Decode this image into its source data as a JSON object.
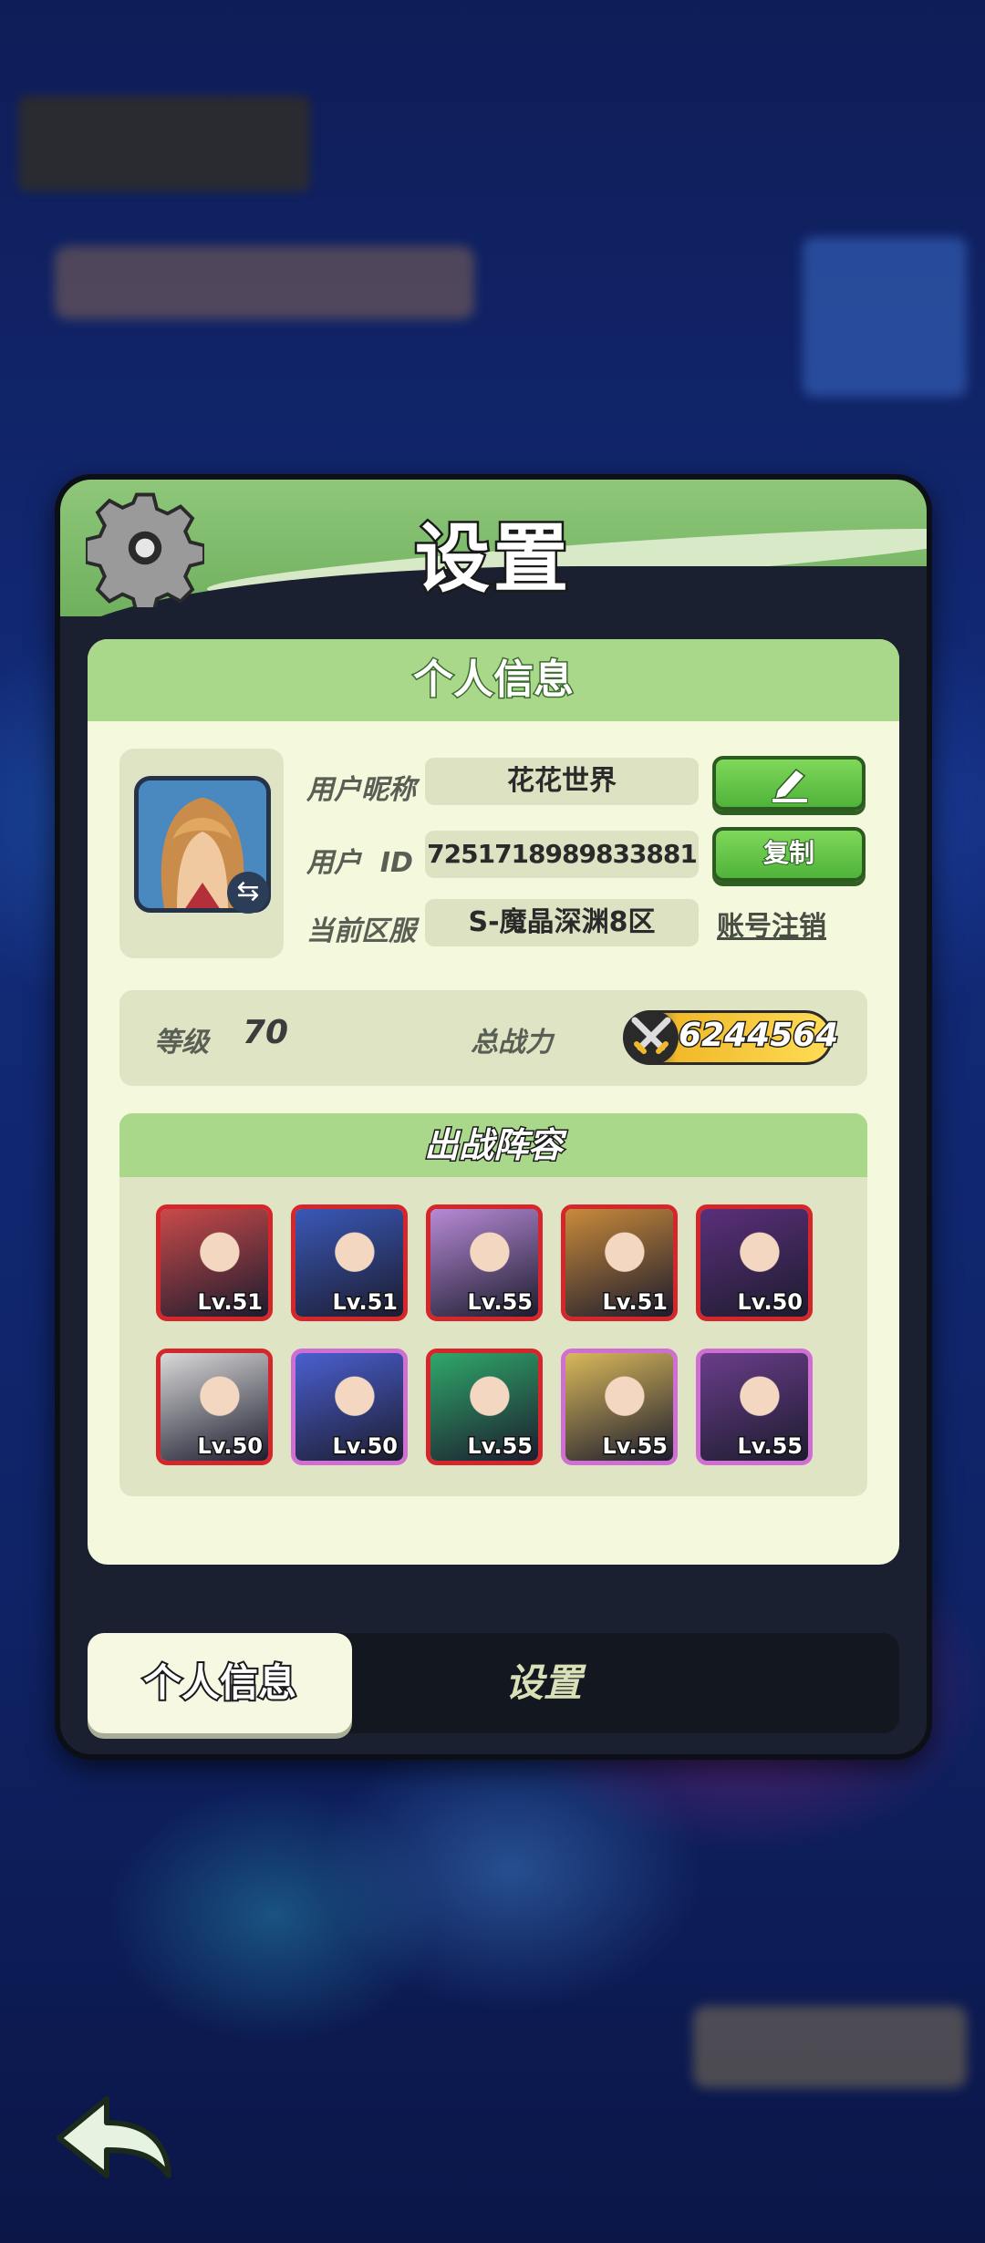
{
  "dialog": {
    "title": "设置",
    "gear_icon": "gear-icon"
  },
  "info_card": {
    "header": "个人信息",
    "nickname_label": "用户昵称",
    "nickname_value": "花花世界",
    "userid_label": "用户  ID",
    "userid_value": "7251718989833881",
    "server_label": "当前区服",
    "server_value": "S-魔晶深渊8区",
    "edit_button_icon": "pencil-icon",
    "copy_button_label": "复制",
    "delete_account_label": "账号注销",
    "level_label": "等级",
    "level_value": "70",
    "power_label": "总战力",
    "power_value": "6244564"
  },
  "lineup": {
    "header": "出战阵容",
    "heroes": [
      {
        "level": "Lv.51",
        "frame": "red",
        "color": "#c94a4a"
      },
      {
        "level": "Lv.51",
        "frame": "red",
        "color": "#3a58b8"
      },
      {
        "level": "Lv.55",
        "frame": "red",
        "color": "#b78ad6"
      },
      {
        "level": "Lv.51",
        "frame": "red",
        "color": "#c98a3a"
      },
      {
        "level": "Lv.50",
        "frame": "red",
        "color": "#5b2f7a"
      },
      {
        "level": "Lv.50",
        "frame": "red",
        "color": "#d9d9d9"
      },
      {
        "level": "Lv.50",
        "frame": "purple",
        "color": "#4a5fd0"
      },
      {
        "level": "Lv.55",
        "frame": "red",
        "color": "#2fa86a"
      },
      {
        "level": "Lv.55",
        "frame": "purple",
        "color": "#d9b85a"
      },
      {
        "level": "Lv.55",
        "frame": "purple",
        "color": "#6a3d8a"
      }
    ]
  },
  "tabs": {
    "personal_info": "个人信息",
    "settings": "设置"
  },
  "back_button_icon": "back-arrow-icon"
}
